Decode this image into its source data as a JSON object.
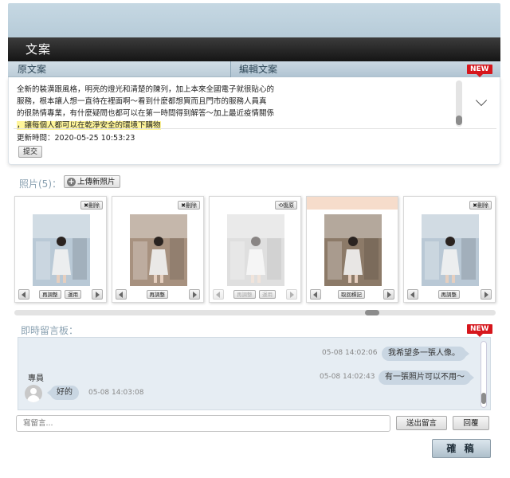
{
  "header": {
    "title": "文案",
    "tab_original": "原文案",
    "tab_edit": "編輯文案",
    "new_badge": "NEW"
  },
  "copy": {
    "lines": [
      "全新的裝潢跟風格，明亮的燈光和清楚的陳列，加上本來全國電子就很貼心的",
      "服務，根本讓人想一直待在裡面啊～看到什麼都想買而且門市的服務人員真",
      "的很熱情專業，有什麼疑問也都可以在第一時間得到解答～加上最近疫情關係"
    ],
    "highlight": "，讓每個人都可以在乾淨安全的環境下購物",
    "updated_label": "更新時間：",
    "updated_value": "2020-05-25 10:53:23",
    "submit_label": "提交"
  },
  "photos": {
    "heading": "照片(5)：",
    "upload_label": "上傳新照片",
    "delete_label": "✖刪除",
    "restore_label": "⟲復原",
    "adjust_label": "再調整",
    "apply_label": "運用",
    "restore_mark_label": "取回標記",
    "items": [
      {
        "corner": "✖刪除",
        "buttons": [
          "再調整",
          "運用"
        ],
        "state": "active",
        "scene": "#b9c9d6"
      },
      {
        "corner": "✖刪除",
        "buttons": [
          "再調整"
        ],
        "state": "active",
        "scene": "#a7917f"
      },
      {
        "corner": "⟲復原",
        "buttons": [
          "再調整",
          "運用"
        ],
        "state": "disabled",
        "scene": "#c6c6c6"
      },
      {
        "corner": "",
        "buttons": [
          "取回標記"
        ],
        "state": "marked",
        "scene": "#8c7a68"
      },
      {
        "corner": "✖刪除",
        "buttons": [
          "再調整"
        ],
        "state": "active",
        "scene": "#b9c8d5"
      }
    ]
  },
  "chat": {
    "heading": "即時留言板：",
    "new_badge": "NEW",
    "messages": [
      {
        "side": "right",
        "time": "05-08 14:02:06",
        "text": "我希望多一張人像。"
      },
      {
        "side": "right",
        "time": "05-08 14:02:43",
        "text": "有一張照片可以不用～"
      },
      {
        "side": "left",
        "sender": "專員",
        "time": "05-08 14:03:08",
        "text": "好的"
      }
    ],
    "input_placeholder": "寫留言...",
    "send_label": "送出留言",
    "reply_label": "回覆"
  },
  "confirm_label": "確 稿"
}
